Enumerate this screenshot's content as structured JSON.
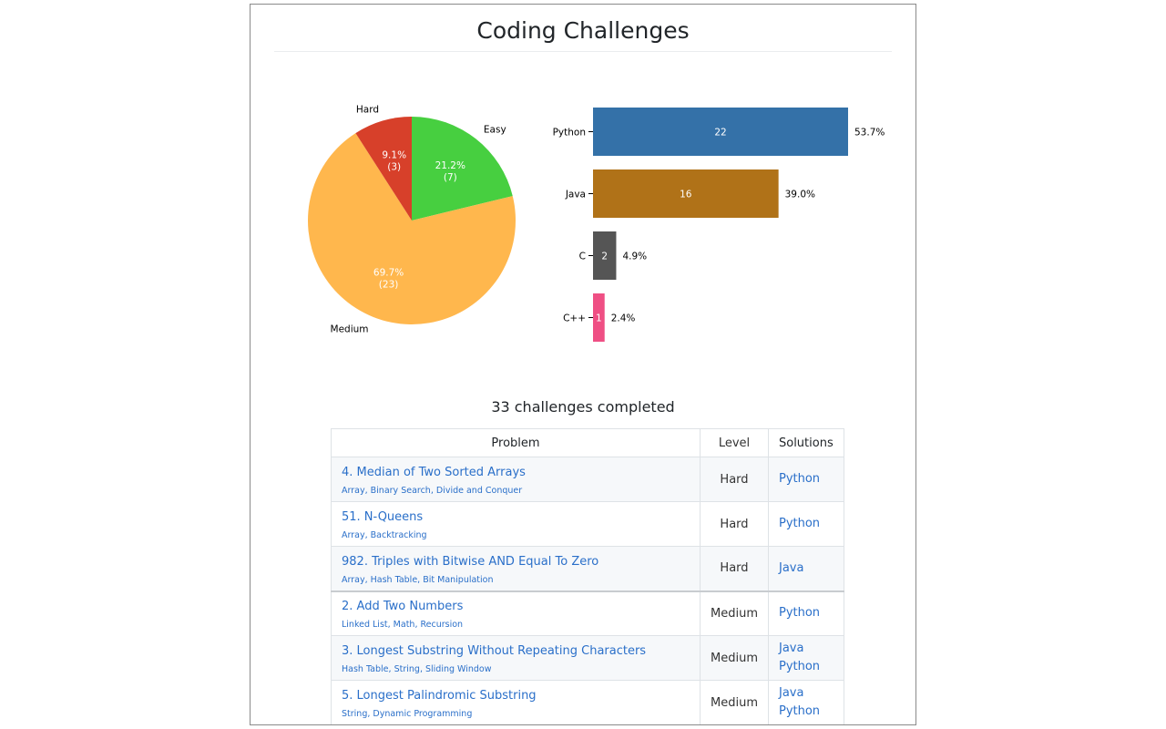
{
  "page": {
    "title": "Coding Challenges"
  },
  "chart_data": [
    {
      "type": "pie",
      "title": "",
      "slices": [
        {
          "label": "Easy",
          "percent_label": "21.2%",
          "count_label": "(7)",
          "value": 7,
          "color": "#47cf40"
        },
        {
          "label": "Medium",
          "percent_label": "69.7%",
          "count_label": "(23)",
          "value": 23,
          "color": "#ffb74d"
        },
        {
          "label": "Hard",
          "percent_label": "9.1%",
          "count_label": "(3)",
          "value": 3,
          "color": "#d7402a"
        }
      ]
    },
    {
      "type": "bar",
      "orientation": "horizontal",
      "title": "",
      "xlabel": "",
      "ylabel": "",
      "xlim": [
        0,
        22
      ],
      "categories": [
        "Python",
        "Java",
        "C",
        "C++"
      ],
      "values": [
        22,
        16,
        2,
        1
      ],
      "value_labels": [
        "22",
        "16",
        "2",
        "1"
      ],
      "percent_labels": [
        "53.7%",
        "39.0%",
        "4.9%",
        "2.4%"
      ],
      "colors": [
        "#3471a8",
        "#b07218",
        "#555555",
        "#ef4f84"
      ]
    }
  ],
  "summary": {
    "text": "33 challenges completed"
  },
  "table": {
    "headers": {
      "problem": "Problem",
      "level": "Level",
      "solutions": "Solutions"
    },
    "rows": [
      {
        "title": "4. Median of Two Sorted Arrays",
        "tags": [
          "Array",
          "Binary Search",
          "Divide and Conquer"
        ],
        "level": "Hard",
        "solutions": [
          "Python"
        ]
      },
      {
        "title": "51. N-Queens",
        "tags": [
          "Array",
          "Backtracking"
        ],
        "level": "Hard",
        "solutions": [
          "Python"
        ]
      },
      {
        "title": "982. Triples with Bitwise AND Equal To Zero",
        "tags": [
          "Array",
          "Hash Table",
          "Bit Manipulation"
        ],
        "level": "Hard",
        "solutions": [
          "Java"
        ]
      },
      {
        "title": "2. Add Two Numbers",
        "tags": [
          "Linked List",
          "Math",
          "Recursion"
        ],
        "level": "Medium",
        "solutions": [
          "Python"
        ]
      },
      {
        "title": "3. Longest Substring Without Repeating Characters",
        "tags": [
          "Hash Table",
          "String",
          "Sliding Window"
        ],
        "level": "Medium",
        "solutions": [
          "Java",
          "Python"
        ]
      },
      {
        "title": "5. Longest Palindromic Substring",
        "tags": [
          "String",
          "Dynamic Programming"
        ],
        "level": "Medium",
        "solutions": [
          "Java",
          "Python"
        ]
      }
    ]
  }
}
